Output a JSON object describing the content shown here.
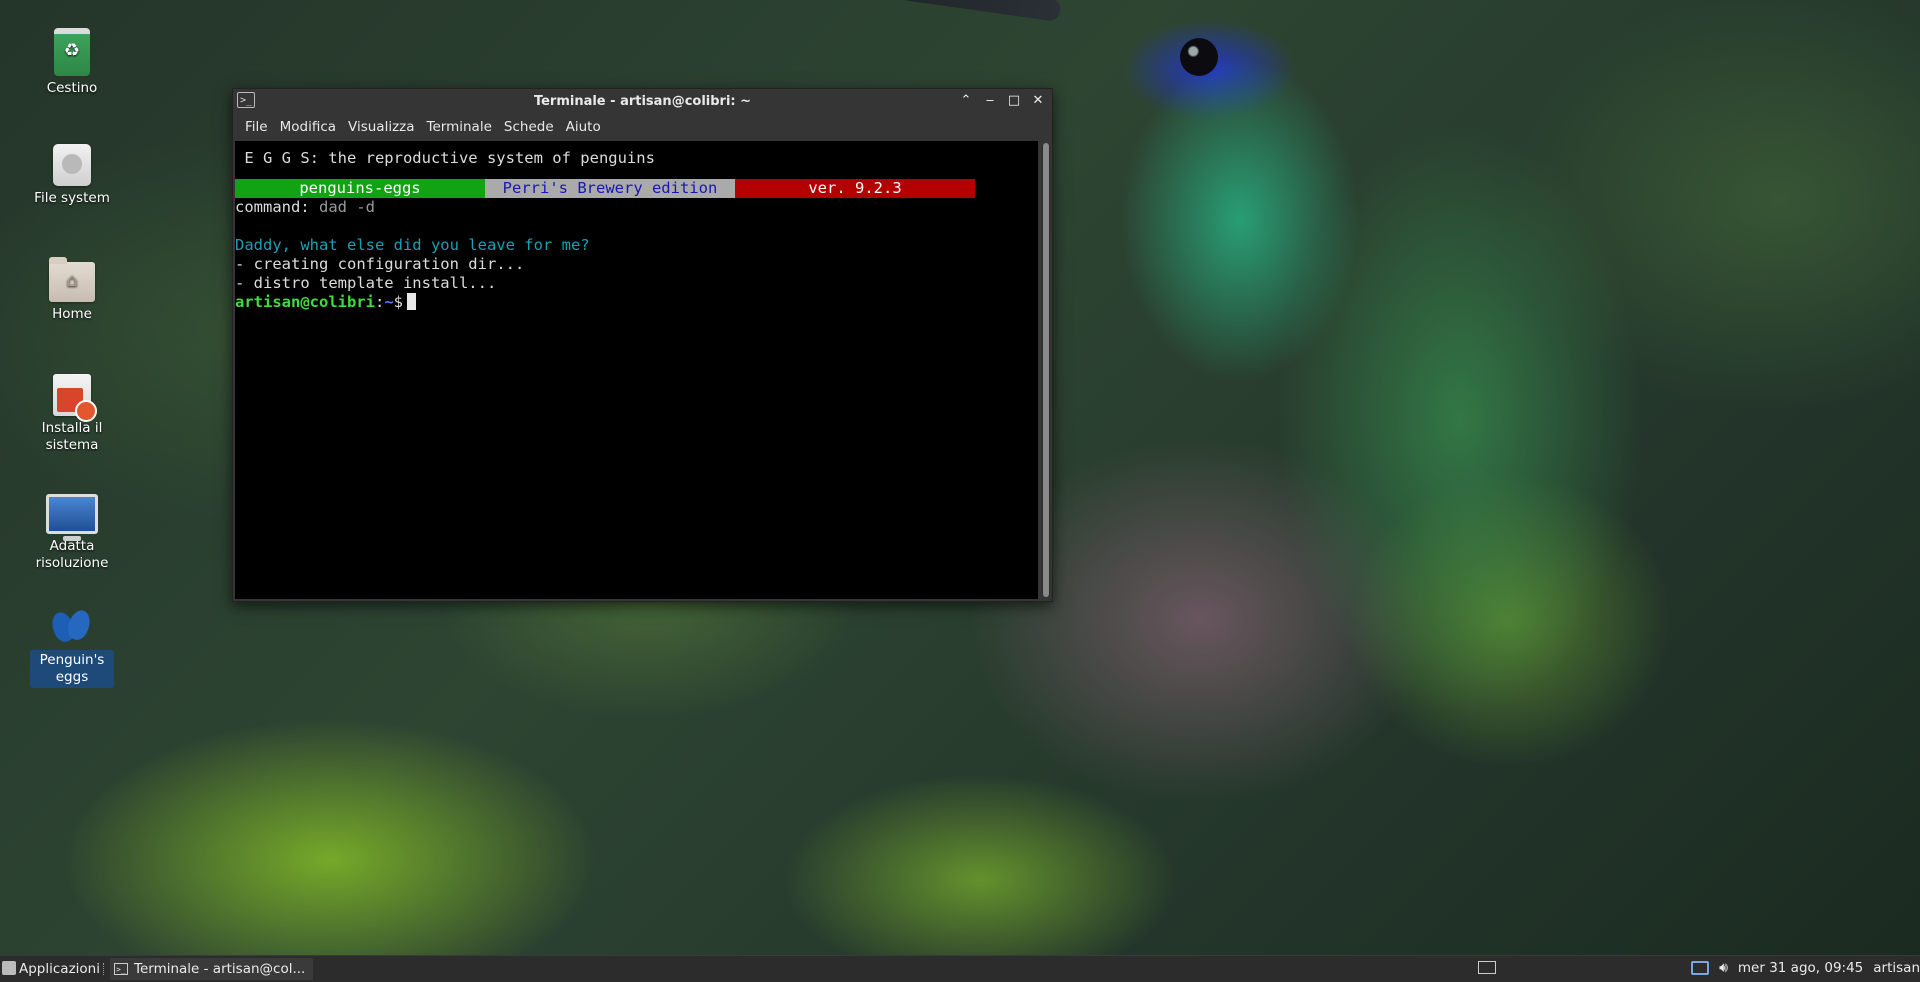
{
  "desktop": {
    "icons": [
      {
        "label": "Cestino"
      },
      {
        "label": "File system"
      },
      {
        "label": "Home"
      },
      {
        "label": "Installa il sistema"
      },
      {
        "label": "Adatta risoluzione"
      },
      {
        "label": "Penguin's eggs"
      }
    ]
  },
  "window": {
    "title": "Terminale - artisan@colibri: ~",
    "controls": {
      "shade": "⌃",
      "minimize": "‒",
      "maximize": "□",
      "close": "✕"
    },
    "menu": [
      "File",
      "Modifica",
      "Visualizza",
      "Terminale",
      "Schede",
      "Aiuto"
    ]
  },
  "terminal": {
    "header": " E G G S: the reproductive system of penguins",
    "banner": {
      "name": "penguins-eggs",
      "edition": "Perri's Brewery edition",
      "version": "ver. 9.2.3"
    },
    "command_label": "command: ",
    "command_value": "dad -d",
    "question": "Daddy, what else did you leave for me?",
    "steps": [
      "- creating configuration dir...",
      "- distro template install..."
    ],
    "prompt": {
      "user": "artisan@colibri",
      "sep": ":",
      "path": "~",
      "symbol": "$"
    }
  },
  "taskbar": {
    "apps_label": "Applicazioni",
    "task_label": "Terminale - artisan@col...",
    "clock": "mer 31 ago, 09:45",
    "user": "artisan"
  },
  "colors": {
    "banner_green": "#12a312",
    "banner_gray": "#aaaaaa",
    "banner_red": "#b30000",
    "prompt_user": "#3fdc3f",
    "prompt_path": "#5a78ff",
    "question_cyan": "#19a0b3"
  },
  "icons": {
    "trash": "recycle-trash-icon",
    "filesystem": "drive-icon",
    "home": "home-folder-icon",
    "installer": "installer-icon",
    "display": "monitor-icon",
    "eggs": "penguins-eggs-icon",
    "terminal": "terminal-icon",
    "network": "network-icon",
    "volume": "volume-icon"
  }
}
